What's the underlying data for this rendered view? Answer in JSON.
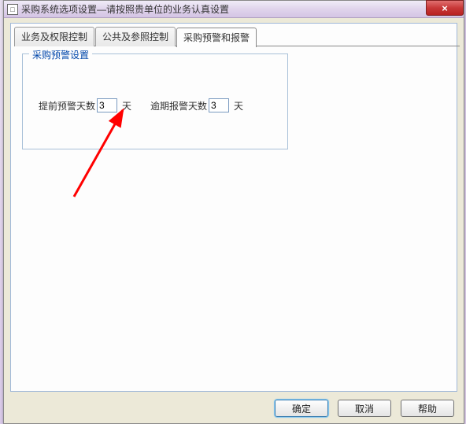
{
  "window": {
    "title": "采购系统选项设置—请按照贵单位的业务认真设置"
  },
  "tabs": {
    "t0": "业务及权限控制",
    "t1": "公共及参照控制",
    "t2": "采购预警和报警"
  },
  "fieldset": {
    "legend": "采购预警设置",
    "advance_label": "提前预警天数",
    "advance_value": "3",
    "advance_unit": "天",
    "overdue_label": "逾期报警天数",
    "overdue_value": "3",
    "overdue_unit": "天"
  },
  "buttons": {
    "ok": "确定",
    "cancel": "取消",
    "help": "帮助"
  },
  "close_glyph": "×"
}
